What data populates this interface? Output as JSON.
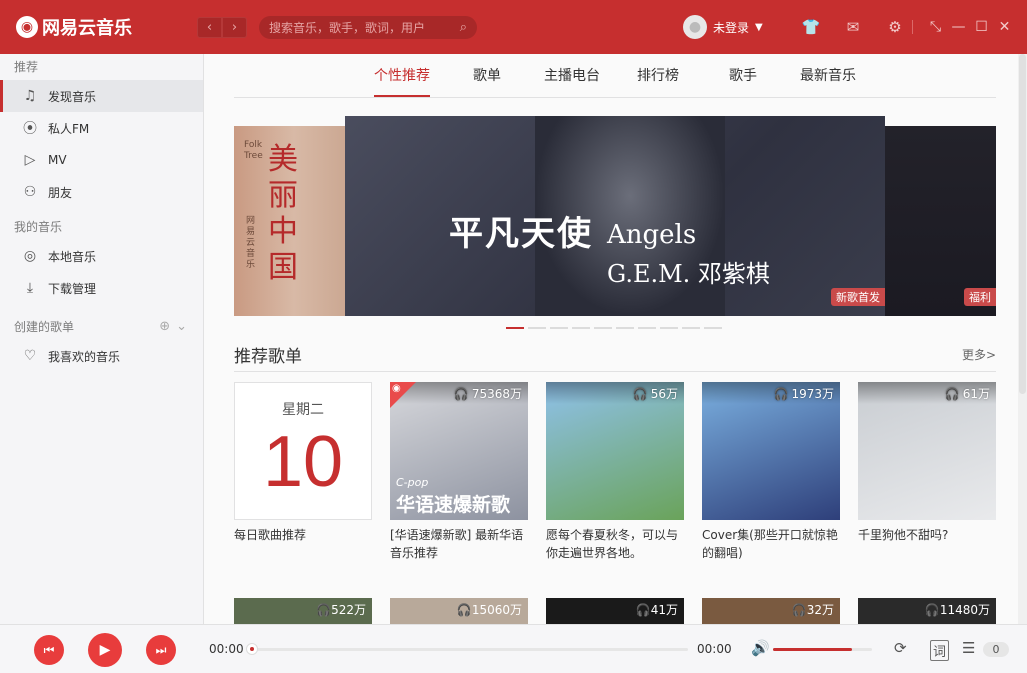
{
  "app": {
    "name": "网易云音乐",
    "logo_icon": "netease-logo-icon"
  },
  "header": {
    "back": "‹",
    "forward": "›",
    "search_placeholder": "搜索音乐，歌手，歌词，用户",
    "user_name": "未登录",
    "icons": [
      "skin-icon",
      "mail-icon",
      "settings-icon"
    ],
    "window": [
      "mini-mode-icon",
      "minimize-icon",
      "maximize-icon",
      "close-icon"
    ]
  },
  "sidebar": {
    "sections": [
      {
        "title": "推荐",
        "items": [
          {
            "label": "发现音乐",
            "icon": "music-note-icon",
            "active": true
          },
          {
            "label": "私人FM",
            "icon": "radio-icon"
          },
          {
            "label": "MV",
            "icon": "video-icon"
          },
          {
            "label": "朋友",
            "icon": "friends-icon"
          }
        ]
      },
      {
        "title": "我的音乐",
        "items": [
          {
            "label": "本地音乐",
            "icon": "disc-icon"
          },
          {
            "label": "下载管理",
            "icon": "download-icon"
          }
        ]
      },
      {
        "title": "创建的歌单",
        "items": [
          {
            "label": "我喜欢的音乐",
            "icon": "heart-icon"
          }
        ]
      }
    ]
  },
  "tabs": [
    "个性推荐",
    "歌单",
    "主播电台",
    "排行榜",
    "歌手",
    "最新音乐"
  ],
  "banner": {
    "title_cn": "平凡天使",
    "title_en": "Angels",
    "artist": "G.E.M. 邓紫棋",
    "center_tag": "新歌首发",
    "right_tag": "福利",
    "left_text": "美丽中国",
    "left_sub": "网易云音乐",
    "left_brand": "Folk Tree",
    "dots": 10,
    "active_dot": 0
  },
  "playlist_section": {
    "title": "推荐歌单",
    "more": "更多>"
  },
  "daily": {
    "weekday": "星期二",
    "day": "10",
    "title": "每日歌曲推荐"
  },
  "playlists": [
    {
      "count": "75368万",
      "title": "[华语速爆新歌] 最新华语音乐推荐",
      "cover_text": "C-pop",
      "cover_big": "华语速爆新歌",
      "c1": "#d7d8dc",
      "c2": "#8d92a0"
    },
    {
      "count": "56万",
      "title": "愿每个春夏秋冬，可以与你走遍世界各地。",
      "c1": "#8fc1ea",
      "c2": "#6aa35a"
    },
    {
      "count": "1973万",
      "title": "Cover集(那些开口就惊艳的翻唱)",
      "c1": "#7bb0e0",
      "c2": "#2e3f7a"
    },
    {
      "count": "61万",
      "title": "千里狗他不甜吗?",
      "c1": "#c9cdd2",
      "c2": "#e9eaec"
    }
  ],
  "row2": [
    {
      "count": "522万",
      "c": "#5b6b4e"
    },
    {
      "count": "15060万",
      "c": "#b8a99a"
    },
    {
      "count": "41万",
      "c": "#1a1a1a"
    },
    {
      "count": "32万",
      "c": "#7a5a40"
    },
    {
      "count": "11480万",
      "c": "#2a2a2a"
    }
  ],
  "player": {
    "prev": "⏮",
    "play": "▶",
    "next": "⏭",
    "time_current": "00:00",
    "time_total": "00:00",
    "volume": 0.8,
    "lyric": "词",
    "queue_count": "0"
  }
}
